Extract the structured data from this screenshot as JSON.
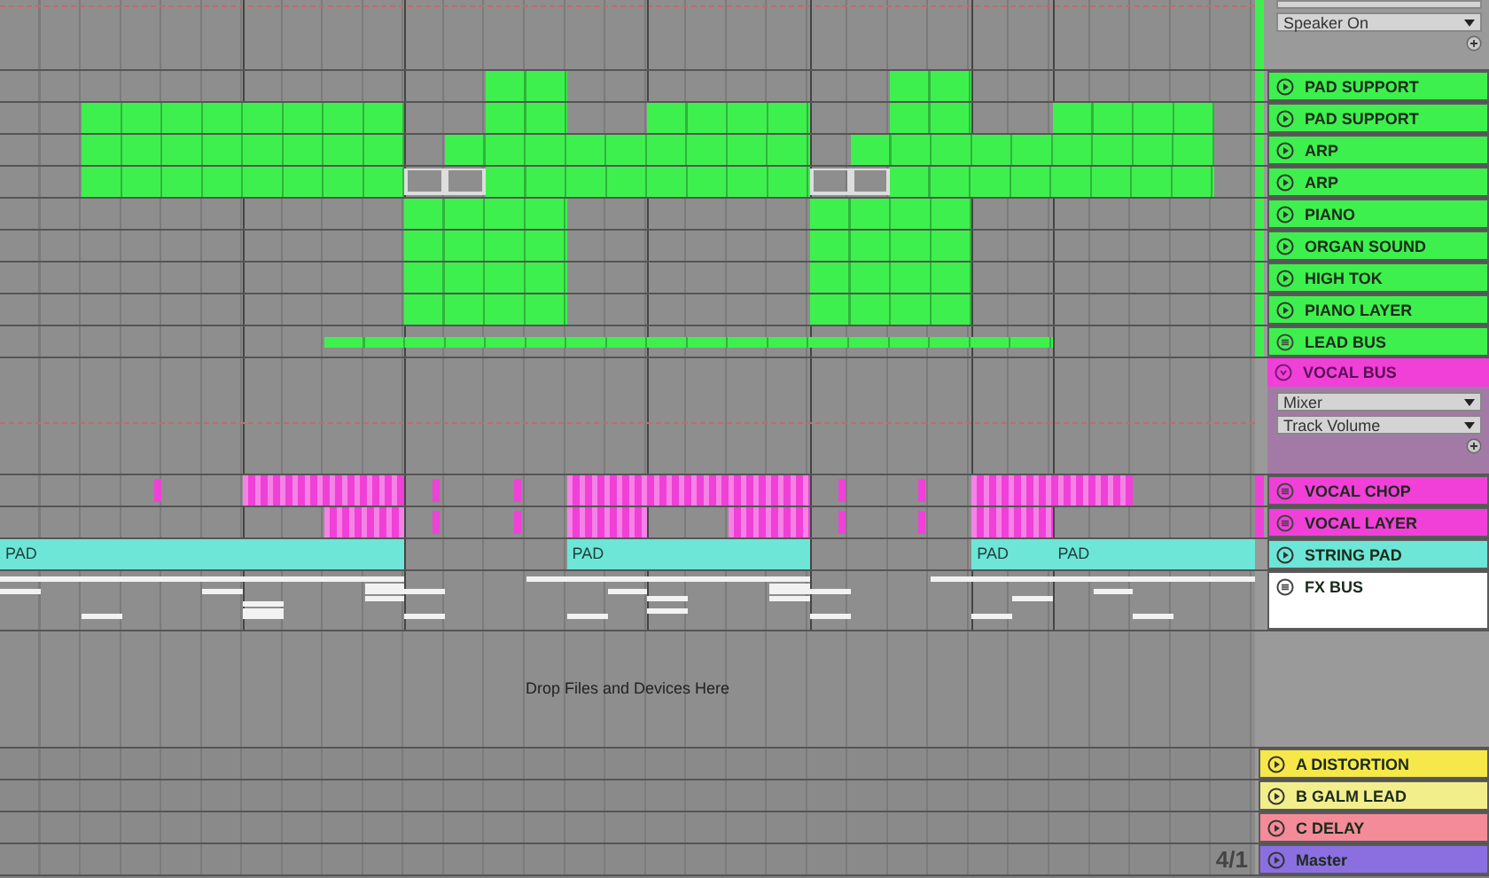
{
  "top_group": {
    "color": "#3ef04e",
    "dropdowns": [
      "Speaker On"
    ]
  },
  "tracks": [
    {
      "name": "PAD SUPPORT",
      "kind": "track",
      "color": "#3ef04e"
    },
    {
      "name": "PAD SUPPORT",
      "kind": "track",
      "color": "#3ef04e"
    },
    {
      "name": "ARP",
      "kind": "track",
      "color": "#3ef04e"
    },
    {
      "name": "ARP",
      "kind": "track",
      "color": "#3ef04e"
    },
    {
      "name": "PIANO",
      "kind": "track",
      "color": "#3ef04e"
    },
    {
      "name": "ORGAN SOUND",
      "kind": "track",
      "color": "#3ef04e"
    },
    {
      "name": "HIGH TOK",
      "kind": "track",
      "color": "#3ef04e"
    },
    {
      "name": "PIANO LAYER",
      "kind": "track",
      "color": "#3ef04e"
    },
    {
      "name": "LEAD BUS",
      "kind": "bus",
      "color": "#3ef04e"
    },
    {
      "name": "VOCAL BUS",
      "kind": "group",
      "color": "#f040d8",
      "dropdowns": [
        "Mixer",
        "Track Volume"
      ]
    },
    {
      "name": "VOCAL CHOP",
      "kind": "bus",
      "color": "#f040d8"
    },
    {
      "name": "VOCAL LAYER",
      "kind": "bus",
      "color": "#f040d8"
    },
    {
      "name": "STRING PAD",
      "kind": "track",
      "color": "#6de6d8",
      "clips": [
        "PAD",
        "PAD",
        "PAD",
        "PAD"
      ]
    },
    {
      "name": "FX BUS",
      "kind": "fx",
      "color": "#ffffff"
    }
  ],
  "drop_area": "Drop Files and Devices Here",
  "returns": [
    {
      "name": "A DISTORTION",
      "color": "#f6e84a"
    },
    {
      "name": "B GALM LEAD",
      "color": "#f3ee8c"
    },
    {
      "name": "C DELAY",
      "color": "#f38b98"
    },
    {
      "name": "Master",
      "color": "#8b6fe0"
    }
  ],
  "zoom_label": "4/1"
}
